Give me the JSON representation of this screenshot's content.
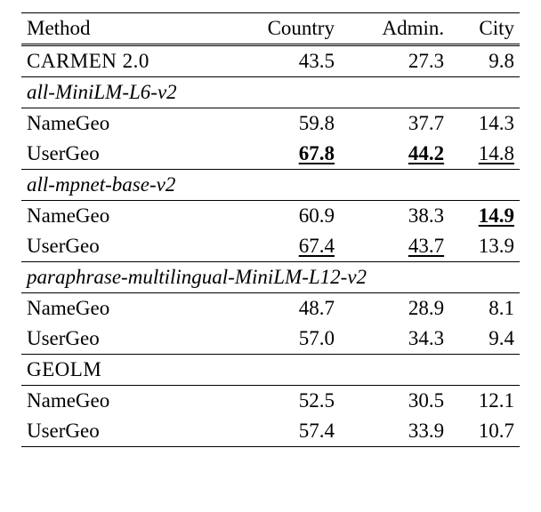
{
  "chart_data": {
    "type": "table",
    "columns": [
      "Method",
      "Country",
      "Admin.",
      "City"
    ],
    "groups": [
      {
        "header": null,
        "header_style": null,
        "rows": [
          {
            "method": "CARMEN 2.0",
            "method_style": "sc",
            "country": "43.5",
            "admin": "27.3",
            "city": "9.8"
          }
        ]
      },
      {
        "header": "all-MiniLM-L6-v2",
        "header_style": "it",
        "rows": [
          {
            "method": "NameGeo",
            "country": "59.8",
            "admin": "37.7",
            "city": "14.3"
          },
          {
            "method": "UserGeo",
            "country": "67.8",
            "country_style": "b u",
            "admin": "44.2",
            "admin_style": "b u",
            "city": "14.8",
            "city_style": "u"
          }
        ]
      },
      {
        "header": "all-mpnet-base-v2",
        "header_style": "it",
        "rows": [
          {
            "method": "NameGeo",
            "country": "60.9",
            "admin": "38.3",
            "city": "14.9",
            "city_style": "b u"
          },
          {
            "method": "UserGeo",
            "country": "67.4",
            "country_style": "u",
            "admin": "43.7",
            "admin_style": "u",
            "city": "13.9"
          }
        ]
      },
      {
        "header": "paraphrase-multilingual-MiniLM-L12-v2",
        "header_style": "it",
        "rows": [
          {
            "method": "NameGeo",
            "country": "48.7",
            "admin": "28.9",
            "city": "8.1"
          },
          {
            "method": "UserGeo",
            "country": "57.0",
            "admin": "34.3",
            "city": "9.4"
          }
        ]
      },
      {
        "header": "GEOLM",
        "header_style": "sc",
        "rows": [
          {
            "method": "NameGeo",
            "country": "52.5",
            "admin": "30.5",
            "city": "12.1"
          },
          {
            "method": "UserGeo",
            "country": "57.4",
            "admin": "33.9",
            "city": "10.7"
          }
        ]
      }
    ]
  }
}
